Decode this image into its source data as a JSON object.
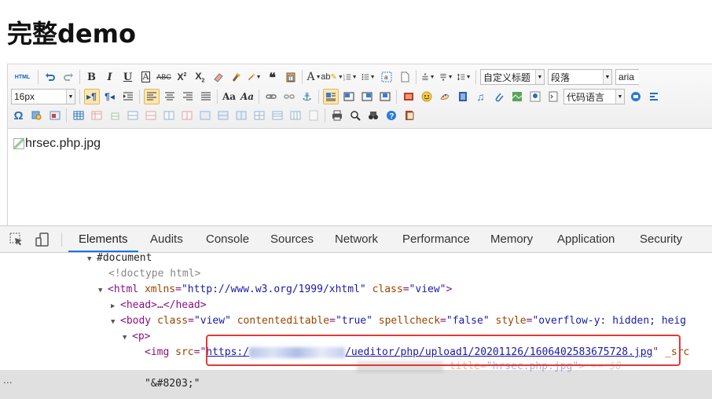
{
  "page": {
    "title": "完整demo"
  },
  "toolbar": {
    "custom_title_select": "自定义标题",
    "paragraph_select": "段落",
    "font_family_select": "aria",
    "font_size_select": "16px",
    "code_lang_select": "代码语言",
    "html_button": "HTML"
  },
  "editor": {
    "image_alt": "hrsec.php.jpg"
  },
  "devtools": {
    "tabs": [
      "Elements",
      "Audits",
      "Console",
      "Sources",
      "Network",
      "Performance",
      "Memory",
      "Application",
      "Security"
    ],
    "active_tab": "Elements",
    "dom": {
      "document": "#document",
      "doctype": "<!doctype html>",
      "html_open": "<html",
      "html_xmlns_attr": "xmlns",
      "html_xmlns_val": "\"http://www.w3.org/1999/xhtml\"",
      "html_class_attr": "class",
      "html_class_val": "\"view\"",
      "html_close": ">",
      "head": "<head>…</head>",
      "body_open": "<body",
      "body_class_attr": "class",
      "body_class_val": "\"view\"",
      "body_ce_attr": "contenteditable",
      "body_ce_val": "\"true\"",
      "body_sc_attr": "spellcheck",
      "body_sc_val": "\"false\"",
      "body_style_attr": "style",
      "body_style_val": "\"overflow-y: hidden; heig",
      "p_tag": "<p>",
      "img_open": "<img",
      "img_src_attr": "src",
      "img_src_prefix": "https:/",
      "img_src_path": "/ueditor/php/upload1/20201126/1606402583675728.jpg",
      "img_src_extra": "_src",
      "img_title_attr": "title",
      "img_title_val": "\"hrsec.php.jpg\"",
      "img_close": ">",
      "img_eq": "== $0",
      "zwsp_text": "\"&#8203;\"",
      "ellipsis": "..."
    }
  }
}
